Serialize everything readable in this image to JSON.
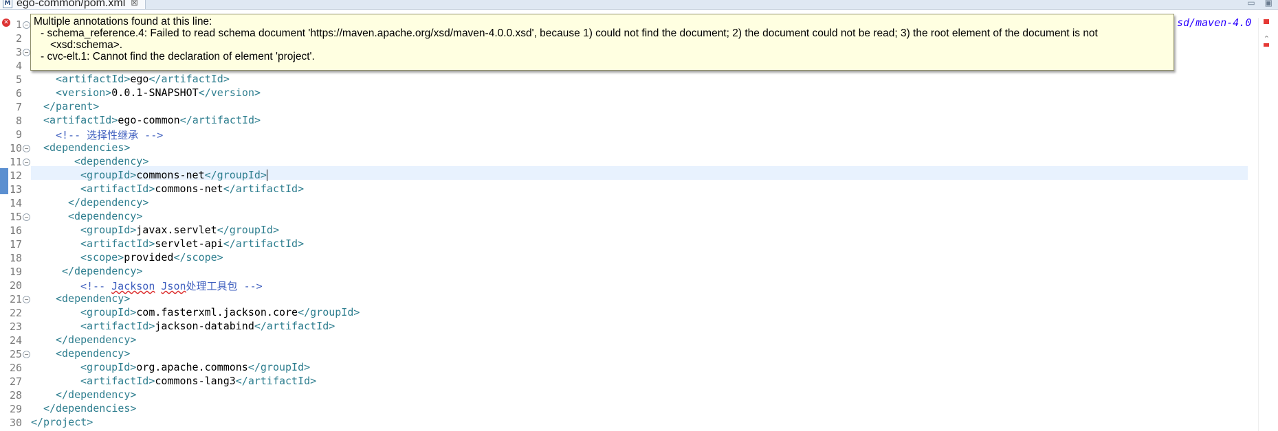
{
  "tab": {
    "icon": "maven-pom-file-icon",
    "title": "ego-common/pom.xml",
    "close": "⊠"
  },
  "window_controls": {
    "minimize": "▭",
    "maximize": "▣"
  },
  "tooltip": {
    "heading": "Multiple annotations found at this line:",
    "line1": "- schema_reference.4: Failed to read schema document 'https://maven.apache.org/xsd/maven-4.0.0.xsd', because 1) could not find the document; 2) the document could not be read; 3) the root element of the document is not",
    "line2": "<xsd:schema>.",
    "line3": "- cvc-elt.1: Cannot find the declaration of element 'project'."
  },
  "overflow_text": "sd/maven-4.0",
  "line_numbers": [
    "1",
    "2",
    "3",
    "4",
    "5",
    "6",
    "7",
    "8",
    "9",
    "10",
    "11",
    "12",
    "13",
    "14",
    "15",
    "16",
    "17",
    "18",
    "19",
    "20",
    "21",
    "22",
    "23",
    "24",
    "25",
    "26",
    "27",
    "28",
    "29",
    "30"
  ],
  "code": {
    "l5": {
      "open": "<artifactId>",
      "text": "ego",
      "close": "</artifactId>"
    },
    "l6": {
      "open": "<version>",
      "text": "0.0.1-SNAPSHOT",
      "close": "</version>"
    },
    "l7": {
      "close": "</parent>"
    },
    "l8": {
      "open": "<artifactId>",
      "text": "ego-common",
      "close": "</artifactId>"
    },
    "l9": {
      "comment": "<!-- 选择性继承 -->"
    },
    "l10": {
      "open": "<dependencies>"
    },
    "l11": {
      "open": "<dependency>"
    },
    "l12": {
      "open": "<groupId>",
      "text": "commons-net",
      "close": "</groupId>"
    },
    "l13": {
      "open": "<artifactId>",
      "text": "commons-net",
      "close": "</artifactId>"
    },
    "l14": {
      "close": "</dependency>"
    },
    "l15": {
      "open": "<dependency>"
    },
    "l16": {
      "open": "<groupId>",
      "text": "javax.servlet",
      "close": "</groupId>"
    },
    "l17": {
      "open": "<artifactId>",
      "text": "servlet-api",
      "close": "</artifactId>"
    },
    "l18": {
      "open": "<scope>",
      "text": "provided",
      "close": "</scope>"
    },
    "l19": {
      "close": "</dependency>"
    },
    "l20": {
      "c_start": "<!-- ",
      "w1": "Jackson",
      "sp": " ",
      "w2": "Json",
      "c_end": "处理工具包 -->"
    },
    "l21": {
      "open": "<dependency>"
    },
    "l22": {
      "open": "<groupId>",
      "text": "com.fasterxml.jackson.core",
      "close": "</groupId>"
    },
    "l23": {
      "open": "<artifactId>",
      "text": "jackson-databind",
      "close": "</artifactId>"
    },
    "l24": {
      "close": "</dependency>"
    },
    "l25": {
      "open": "<dependency>"
    },
    "l26": {
      "open": "<groupId>",
      "text": "org.apache.commons",
      "close": "</groupId>"
    },
    "l27": {
      "open": "<artifactId>",
      "text": "commons-lang3",
      "close": "</artifactId>"
    },
    "l28": {
      "close": "</dependency>"
    },
    "l29": {
      "close": "</dependencies>"
    },
    "l30": {
      "close": "</project>"
    }
  },
  "colors": {
    "tag": "#2e7e8f",
    "comment": "#3f5fbf",
    "current_line": "#e8f2fe",
    "tooltip_bg": "#ffffe1",
    "error": "#d33333"
  }
}
